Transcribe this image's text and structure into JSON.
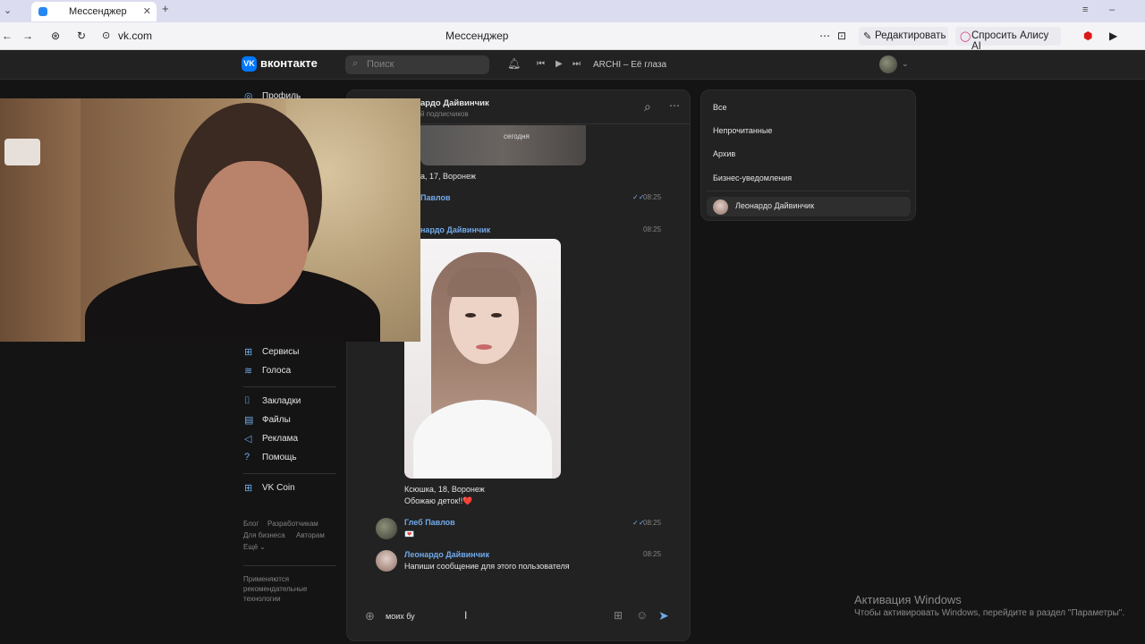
{
  "browser": {
    "tab_title": "Мессенджер",
    "address": "vk.com",
    "page_title": "Мессенджер",
    "edit_label": "Редактировать",
    "alice_label": "Спросить Алису AI"
  },
  "vk": {
    "logo": "вконтакте",
    "search_placeholder": "Поиск",
    "track": "ARCHI – Её глаза"
  },
  "nav": {
    "profile": "Профиль",
    "items_lower": [
      {
        "label": "Сервисы",
        "icon": "grid-icon"
      },
      {
        "label": "Голоса",
        "icon": "coins-icon"
      }
    ],
    "items_group2": [
      {
        "label": "Закладки",
        "icon": "bookmark-icon"
      },
      {
        "label": "Файлы",
        "icon": "file-icon"
      },
      {
        "label": "Реклама",
        "icon": "megaphone-icon"
      },
      {
        "label": "Помощь",
        "icon": "help-icon"
      }
    ],
    "vkcoin": "VK Coin",
    "footer_links": [
      "Блог",
      "Разработчикам",
      "Для бизнеса",
      "Авторам",
      "Ещё"
    ],
    "recommend_note": "Применяются рекомендательные технологии"
  },
  "chat": {
    "header_name": "ардо Дайвинчик",
    "header_sub": "й подписчиков",
    "prev_photo_label": "сегодня",
    "prev_caption": "а, 17, Воронеж",
    "messages": [
      {
        "author": "Павлов",
        "time": "08:25"
      },
      {
        "author": "нардо Дайвинчик",
        "time": "08:25"
      },
      {
        "author": "Глеб Павлов",
        "time": "08:25",
        "text": "💌"
      },
      {
        "author": "Леонардо Дайвинчик",
        "time": "08:25",
        "text": "Напиши сообщение для этого пользователя"
      }
    ],
    "photo_caption_1": "Ксюшка, 18, Воронеж",
    "photo_caption_2": "Обожаю деток!!❤️",
    "compose_value": "моих бу"
  },
  "filters": {
    "items": [
      "Все",
      "Непрочитанные",
      "Архив",
      "Бизнес-уведомления"
    ],
    "active": "Леонардо Дайвинчик"
  },
  "watermark": {
    "title": "Активация Windows",
    "text": "Чтобы активировать Windows, перейдите в раздел \"Параметры\"."
  },
  "colors": {
    "accent": "#71aaeb",
    "vk_blue": "#0077ff",
    "background": "#141414",
    "panel": "#222222"
  }
}
